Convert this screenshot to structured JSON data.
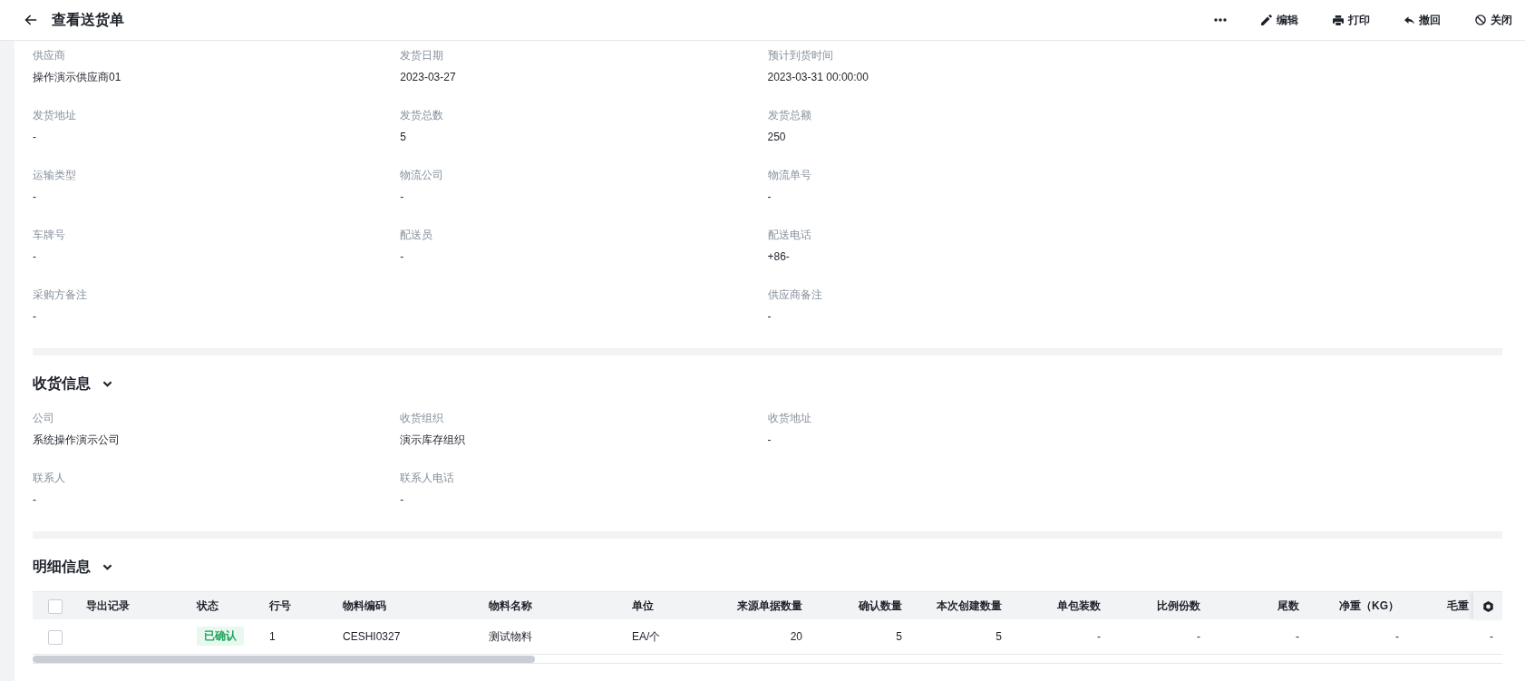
{
  "header": {
    "title": "查看送货单",
    "actions": [
      {
        "kind": "more"
      },
      {
        "kind": "edit",
        "label": "编辑"
      },
      {
        "kind": "print",
        "label": "打印"
      },
      {
        "kind": "revoke",
        "label": "撤回"
      },
      {
        "kind": "close",
        "label": "关闭"
      }
    ]
  },
  "supplier_info": {
    "fields": [
      {
        "label": "供应商",
        "value": "操作演示供应商01",
        "wide": false
      },
      {
        "label": "发货日期",
        "value": "2023-03-27",
        "wide": false
      },
      {
        "label": "预计到货时间",
        "value": "2023-03-31 00:00:00",
        "wide": false
      },
      {
        "label": "发货地址",
        "value": "-",
        "wide": false
      },
      {
        "label": "发货总数",
        "value": "5",
        "wide": false
      },
      {
        "label": "发货总额",
        "value": "250",
        "wide": false
      },
      {
        "label": "运输类型",
        "value": "-",
        "wide": false
      },
      {
        "label": "物流公司",
        "value": "-",
        "wide": false
      },
      {
        "label": "物流单号",
        "value": "-",
        "wide": false
      },
      {
        "label": "车牌号",
        "value": "-",
        "wide": false
      },
      {
        "label": "配送员",
        "value": "-",
        "wide": false
      },
      {
        "label": "配送电话",
        "value": "+86-",
        "wide": false
      },
      {
        "label": "采购方备注",
        "value": "-",
        "wide": true
      },
      {
        "label": "供应商备注",
        "value": "-",
        "wide": false
      }
    ]
  },
  "receiving_info": {
    "title": "收货信息",
    "expanded": true,
    "fields": [
      {
        "label": "公司",
        "value": "系统操作演示公司"
      },
      {
        "label": "收货组织",
        "value": "演示库存组织"
      },
      {
        "label": "收货地址",
        "value": "-"
      },
      {
        "label": "联系人",
        "value": "-"
      },
      {
        "label": "联系人电话",
        "value": "-"
      }
    ]
  },
  "details": {
    "title": "明细信息",
    "expanded": true,
    "table": {
      "select_all": {
        "checked": false
      },
      "columns": [
        {
          "label": "导出记录",
          "kind": "text"
        },
        {
          "label": "状态",
          "kind": "tag"
        },
        {
          "label": "行号",
          "kind": "text"
        },
        {
          "label": "物料编码",
          "kind": "text"
        },
        {
          "label": "物料名称",
          "kind": "text"
        },
        {
          "label": "单位",
          "kind": "text"
        },
        {
          "label": "来源单据数量",
          "kind": "number"
        },
        {
          "label": "确认数量",
          "kind": "number"
        },
        {
          "label": "本次创建数量",
          "kind": "number"
        },
        {
          "label": "单包装数",
          "kind": "number"
        },
        {
          "label": "比例份数",
          "kind": "number"
        },
        {
          "label": "尾数",
          "kind": "number"
        },
        {
          "label": "净重（KG）",
          "kind": "number"
        },
        {
          "label": "毛重",
          "kind": "number"
        }
      ],
      "rows": [
        {
          "checked": false,
          "cells": [
            null,
            "已确认",
            "1",
            "CESHI0327",
            "测试物料",
            "EA/个",
            "20",
            "5",
            "5",
            "-",
            "-",
            "-",
            "-",
            "-"
          ]
        }
      ]
    }
  }
}
